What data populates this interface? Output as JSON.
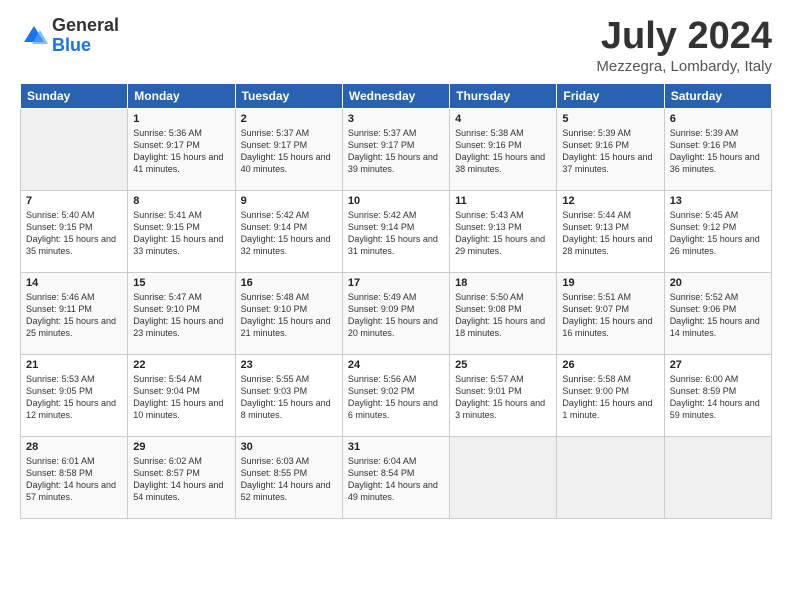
{
  "header": {
    "logo_line1": "General",
    "logo_line2": "Blue",
    "month": "July 2024",
    "location": "Mezzegra, Lombardy, Italy"
  },
  "weekdays": [
    "Sunday",
    "Monday",
    "Tuesday",
    "Wednesday",
    "Thursday",
    "Friday",
    "Saturday"
  ],
  "weeks": [
    [
      {
        "day": "",
        "sunrise": "",
        "sunset": "",
        "daylight": ""
      },
      {
        "day": "1",
        "sunrise": "Sunrise: 5:36 AM",
        "sunset": "Sunset: 9:17 PM",
        "daylight": "Daylight: 15 hours and 41 minutes."
      },
      {
        "day": "2",
        "sunrise": "Sunrise: 5:37 AM",
        "sunset": "Sunset: 9:17 PM",
        "daylight": "Daylight: 15 hours and 40 minutes."
      },
      {
        "day": "3",
        "sunrise": "Sunrise: 5:37 AM",
        "sunset": "Sunset: 9:17 PM",
        "daylight": "Daylight: 15 hours and 39 minutes."
      },
      {
        "day": "4",
        "sunrise": "Sunrise: 5:38 AM",
        "sunset": "Sunset: 9:16 PM",
        "daylight": "Daylight: 15 hours and 38 minutes."
      },
      {
        "day": "5",
        "sunrise": "Sunrise: 5:39 AM",
        "sunset": "Sunset: 9:16 PM",
        "daylight": "Daylight: 15 hours and 37 minutes."
      },
      {
        "day": "6",
        "sunrise": "Sunrise: 5:39 AM",
        "sunset": "Sunset: 9:16 PM",
        "daylight": "Daylight: 15 hours and 36 minutes."
      }
    ],
    [
      {
        "day": "7",
        "sunrise": "Sunrise: 5:40 AM",
        "sunset": "Sunset: 9:15 PM",
        "daylight": "Daylight: 15 hours and 35 minutes."
      },
      {
        "day": "8",
        "sunrise": "Sunrise: 5:41 AM",
        "sunset": "Sunset: 9:15 PM",
        "daylight": "Daylight: 15 hours and 33 minutes."
      },
      {
        "day": "9",
        "sunrise": "Sunrise: 5:42 AM",
        "sunset": "Sunset: 9:14 PM",
        "daylight": "Daylight: 15 hours and 32 minutes."
      },
      {
        "day": "10",
        "sunrise": "Sunrise: 5:42 AM",
        "sunset": "Sunset: 9:14 PM",
        "daylight": "Daylight: 15 hours and 31 minutes."
      },
      {
        "day": "11",
        "sunrise": "Sunrise: 5:43 AM",
        "sunset": "Sunset: 9:13 PM",
        "daylight": "Daylight: 15 hours and 29 minutes."
      },
      {
        "day": "12",
        "sunrise": "Sunrise: 5:44 AM",
        "sunset": "Sunset: 9:13 PM",
        "daylight": "Daylight: 15 hours and 28 minutes."
      },
      {
        "day": "13",
        "sunrise": "Sunrise: 5:45 AM",
        "sunset": "Sunset: 9:12 PM",
        "daylight": "Daylight: 15 hours and 26 minutes."
      }
    ],
    [
      {
        "day": "14",
        "sunrise": "Sunrise: 5:46 AM",
        "sunset": "Sunset: 9:11 PM",
        "daylight": "Daylight: 15 hours and 25 minutes."
      },
      {
        "day": "15",
        "sunrise": "Sunrise: 5:47 AM",
        "sunset": "Sunset: 9:10 PM",
        "daylight": "Daylight: 15 hours and 23 minutes."
      },
      {
        "day": "16",
        "sunrise": "Sunrise: 5:48 AM",
        "sunset": "Sunset: 9:10 PM",
        "daylight": "Daylight: 15 hours and 21 minutes."
      },
      {
        "day": "17",
        "sunrise": "Sunrise: 5:49 AM",
        "sunset": "Sunset: 9:09 PM",
        "daylight": "Daylight: 15 hours and 20 minutes."
      },
      {
        "day": "18",
        "sunrise": "Sunrise: 5:50 AM",
        "sunset": "Sunset: 9:08 PM",
        "daylight": "Daylight: 15 hours and 18 minutes."
      },
      {
        "day": "19",
        "sunrise": "Sunrise: 5:51 AM",
        "sunset": "Sunset: 9:07 PM",
        "daylight": "Daylight: 15 hours and 16 minutes."
      },
      {
        "day": "20",
        "sunrise": "Sunrise: 5:52 AM",
        "sunset": "Sunset: 9:06 PM",
        "daylight": "Daylight: 15 hours and 14 minutes."
      }
    ],
    [
      {
        "day": "21",
        "sunrise": "Sunrise: 5:53 AM",
        "sunset": "Sunset: 9:05 PM",
        "daylight": "Daylight: 15 hours and 12 minutes."
      },
      {
        "day": "22",
        "sunrise": "Sunrise: 5:54 AM",
        "sunset": "Sunset: 9:04 PM",
        "daylight": "Daylight: 15 hours and 10 minutes."
      },
      {
        "day": "23",
        "sunrise": "Sunrise: 5:55 AM",
        "sunset": "Sunset: 9:03 PM",
        "daylight": "Daylight: 15 hours and 8 minutes."
      },
      {
        "day": "24",
        "sunrise": "Sunrise: 5:56 AM",
        "sunset": "Sunset: 9:02 PM",
        "daylight": "Daylight: 15 hours and 6 minutes."
      },
      {
        "day": "25",
        "sunrise": "Sunrise: 5:57 AM",
        "sunset": "Sunset: 9:01 PM",
        "daylight": "Daylight: 15 hours and 3 minutes."
      },
      {
        "day": "26",
        "sunrise": "Sunrise: 5:58 AM",
        "sunset": "Sunset: 9:00 PM",
        "daylight": "Daylight: 15 hours and 1 minute."
      },
      {
        "day": "27",
        "sunrise": "Sunrise: 6:00 AM",
        "sunset": "Sunset: 8:59 PM",
        "daylight": "Daylight: 14 hours and 59 minutes."
      }
    ],
    [
      {
        "day": "28",
        "sunrise": "Sunrise: 6:01 AM",
        "sunset": "Sunset: 8:58 PM",
        "daylight": "Daylight: 14 hours and 57 minutes."
      },
      {
        "day": "29",
        "sunrise": "Sunrise: 6:02 AM",
        "sunset": "Sunset: 8:57 PM",
        "daylight": "Daylight: 14 hours and 54 minutes."
      },
      {
        "day": "30",
        "sunrise": "Sunrise: 6:03 AM",
        "sunset": "Sunset: 8:55 PM",
        "daylight": "Daylight: 14 hours and 52 minutes."
      },
      {
        "day": "31",
        "sunrise": "Sunrise: 6:04 AM",
        "sunset": "Sunset: 8:54 PM",
        "daylight": "Daylight: 14 hours and 49 minutes."
      },
      {
        "day": "",
        "sunrise": "",
        "sunset": "",
        "daylight": ""
      },
      {
        "day": "",
        "sunrise": "",
        "sunset": "",
        "daylight": ""
      },
      {
        "day": "",
        "sunrise": "",
        "sunset": "",
        "daylight": ""
      }
    ]
  ]
}
